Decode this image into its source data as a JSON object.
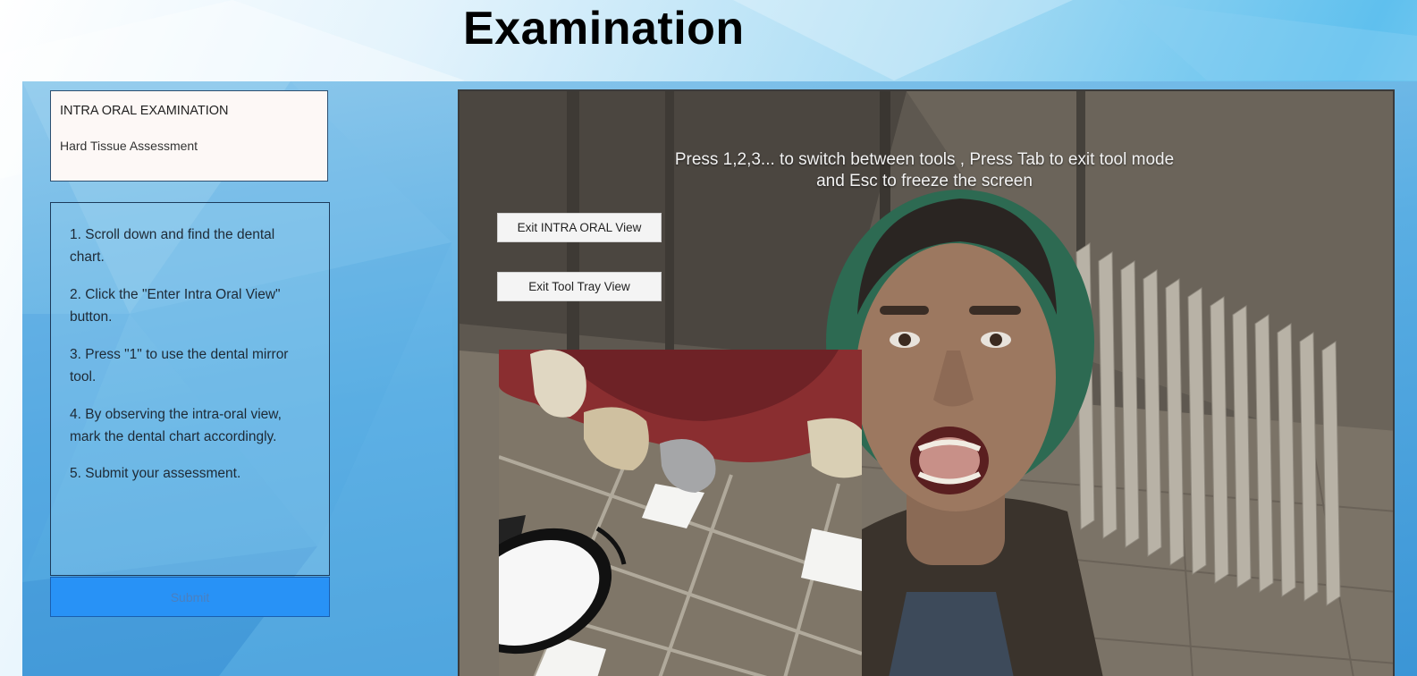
{
  "page": {
    "title": "Examination"
  },
  "header_card": {
    "title": "INTRA ORAL EXAMINATION",
    "subtitle": "Hard Tissue Assessment"
  },
  "instructions": [
    "1. Scroll down and find the dental chart.",
    "2. Click the \"Enter Intra Oral View\" button.",
    "3. Press \"1\" to use the dental mirror tool.",
    "4. By observing the intra-oral view, mark the dental chart accordingly.",
    "5. Submit your assessment."
  ],
  "submit": {
    "label": "Submit"
  },
  "viewport": {
    "hint": "Press 1,2,3... to switch between tools , Press Tab to exit tool mode and Esc to freeze the screen",
    "exit_intra_oral_label": "Exit INTRA ORAL View",
    "exit_tool_tray_label": "Exit Tool Tray View"
  },
  "colors": {
    "submit_bg": "#2892f6",
    "panel_blue": "#3b95d6",
    "card_bg": "#fdf8f6"
  }
}
